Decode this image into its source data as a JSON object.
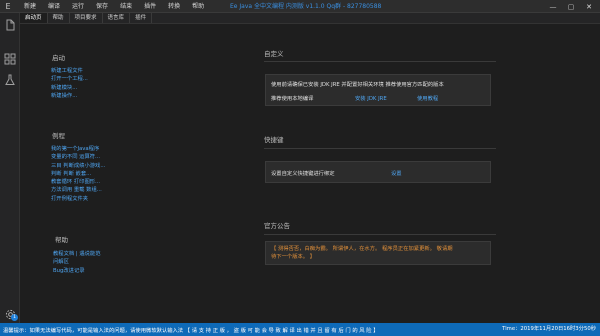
{
  "titlebar": {
    "app_icon": "E",
    "menu": [
      "新建",
      "编译",
      "运行",
      "保存",
      "结束",
      "插件",
      "转换",
      "帮助"
    ],
    "title": "Ee Java 全中文编程 内测版 v1.1.0  Qq群 - 827780588",
    "controls": {
      "minimize": "—",
      "maximize": "▢",
      "close": "✕"
    }
  },
  "tabs": [
    "启动页",
    "帮助",
    "项目要求",
    "语言库",
    "插件"
  ],
  "start": {
    "title": "启动",
    "items": [
      "新建工程文件",
      "打开一个工程...",
      "新建模块...",
      "新建操作..."
    ]
  },
  "examples": {
    "title": "例程",
    "items": [
      "我的第一个Java程序",
      "变量的不同 运算符...",
      "三目 判断成绩小游戏...",
      "判断 判断 嵌套...",
      "教套循环 打印图形...",
      "方法调用 重载 数组...",
      "打开例程文件夹"
    ]
  },
  "help": {
    "title": "帮助",
    "items": [
      "教程文档 | 遇说能范",
      "问解区",
      "Bug改进记录"
    ]
  },
  "custom": {
    "title": "自定义",
    "line1": "使用前请确保已安装 JDK JRE 并配置好相关环境 推荐使用官方匹配的版本",
    "line2": "推荐使用本地编译",
    "link1": "安装 JDK JRE",
    "link2": "使用教程"
  },
  "shortcuts": {
    "title": "快捷键",
    "text": "设置自定义快捷键进行绑定",
    "link": "设置"
  },
  "announcement": {
    "title": "官方公告",
    "text_line1": "【 测得否否，白痴为霸。 所谓伊人，在水方。 程序员正在加紧更新。 敬请期",
    "text_line2": "待下一个版本。 】"
  },
  "statusbar": {
    "text": "温馨提示：如果无法编写代码，可能是输入法的问题，请使用微软默认输入法 【 请 支 持 正 版 ， 盗 版 可 能 会 导 致 解 译 出 错 并 且 留 有 后 门 的 风 险 】",
    "time": "Time：2019年11月20日16时3分50秒"
  },
  "sidebar": {
    "icons": [
      "files-icon",
      "puzzle-icon",
      "flask-icon",
      "gear-icon"
    ],
    "badge": "1"
  },
  "colors": {
    "accent": "#4fa6f2",
    "status": "#0e6ab8",
    "notice": "#e3913a"
  }
}
